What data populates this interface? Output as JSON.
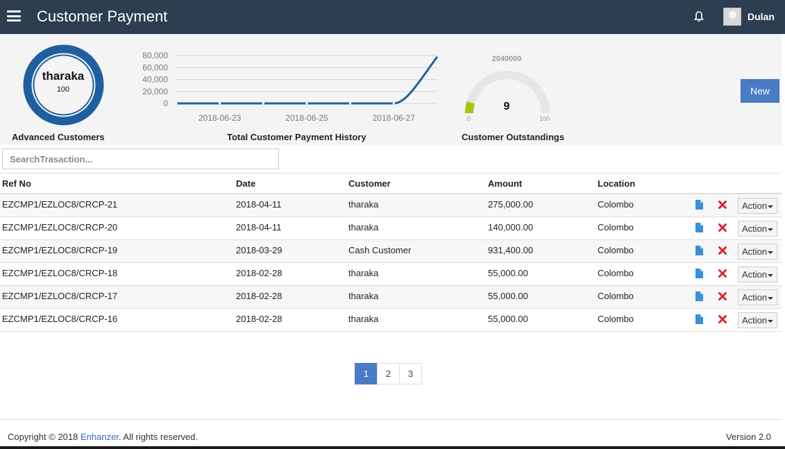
{
  "header": {
    "title": "Customer Payment",
    "username": "Dulan"
  },
  "widgets": {
    "advanced_customers": {
      "label": "Advanced Customers",
      "top_customer": "tharaka",
      "value": "100"
    },
    "payment_history": {
      "label": "Total Customer Payment History"
    },
    "outstandings": {
      "label": "Customer Outstandings",
      "total": "2040000",
      "value": "9",
      "min": "0",
      "max": "100",
      "fill_fraction": 0.09,
      "fill_color": "#a3c80e"
    },
    "new_button": "New"
  },
  "chart_data": {
    "type": "line",
    "title": "",
    "xlabel": "",
    "ylabel": "",
    "x": [
      "2018-06-22",
      "2018-06-23",
      "2018-06-24",
      "2018-06-25",
      "2018-06-26",
      "2018-06-27",
      "2018-06-28"
    ],
    "x_tick_labels": [
      "2018-06-23",
      "2018-06-25",
      "2018-06-27"
    ],
    "y_tick_labels": [
      "80,000",
      "60,000",
      "40,000",
      "20,000",
      "0"
    ],
    "values": [
      0,
      0,
      0,
      0,
      0,
      0,
      78000
    ],
    "ylim": [
      0,
      80000
    ],
    "grid": true,
    "legend": "none",
    "color": "#1f5fa0"
  },
  "search": {
    "placeholder": "SearchTrasaction..."
  },
  "table": {
    "columns": [
      "Ref No",
      "Date",
      "Customer",
      "Amount",
      "Location"
    ],
    "action_label": "Action",
    "rows": [
      {
        "ref": "EZCMP1/EZLOC8/CRCP-21",
        "date": "2018-04-11",
        "customer": "tharaka",
        "amount": "275,000.00",
        "location": "Colombo"
      },
      {
        "ref": "EZCMP1/EZLOC8/CRCP-20",
        "date": "2018-04-11",
        "customer": "tharaka",
        "amount": "140,000.00",
        "location": "Colombo"
      },
      {
        "ref": "EZCMP1/EZLOC8/CRCP-19",
        "date": "2018-03-29",
        "customer": "Cash Customer",
        "amount": "931,400.00",
        "location": "Colombo"
      },
      {
        "ref": "EZCMP1/EZLOC8/CRCP-18",
        "date": "2018-02-28",
        "customer": "tharaka",
        "amount": "55,000.00",
        "location": "Colombo"
      },
      {
        "ref": "EZCMP1/EZLOC8/CRCP-17",
        "date": "2018-02-28",
        "customer": "tharaka",
        "amount": "55,000.00",
        "location": "Colombo"
      },
      {
        "ref": "EZCMP1/EZLOC8/CRCP-16",
        "date": "2018-02-28",
        "customer": "tharaka",
        "amount": "55,000.00",
        "location": "Colombo"
      }
    ]
  },
  "pagination": {
    "pages": [
      "1",
      "2",
      "3"
    ],
    "active": "1"
  },
  "footer": {
    "copyright_prefix": "Copyright © 2018 ",
    "brand": "Enhanzer",
    "copyright_suffix": ". All rights reserved.",
    "version": "Version 2.0"
  },
  "colors": {
    "topbar": "#2c3e50",
    "accent": "#4a7bc6",
    "donut": "#1f5fa0",
    "delete": "#d9262b",
    "doc": "#3a8fd9"
  },
  "icons": {
    "menu": "hamburger-icon",
    "notifications": "bell-icon",
    "row_view": "document-icon",
    "row_delete": "close-icon"
  }
}
